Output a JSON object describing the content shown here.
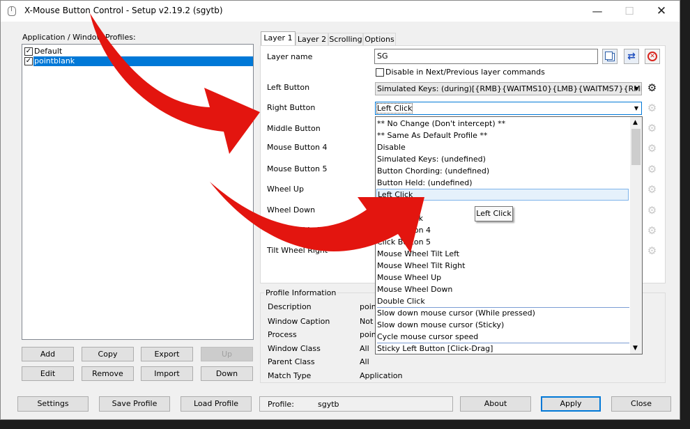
{
  "window": {
    "title": "X-Mouse Button Control - Setup v2.19.2 (sgytb)"
  },
  "profiles": {
    "header": "Application / Window Profiles:",
    "items": [
      {
        "label": "Default",
        "checked": true,
        "selected": false
      },
      {
        "label": "pointblank",
        "checked": true,
        "selected": true
      }
    ],
    "buttons": {
      "add": "Add",
      "copy": "Copy",
      "export": "Export",
      "up": "Up",
      "edit": "Edit",
      "remove": "Remove",
      "import": "Import",
      "down": "Down"
    }
  },
  "tabs": [
    "Layer 1",
    "Layer 2",
    "Scrolling",
    "Options"
  ],
  "layer": {
    "name_label": "Layer name",
    "name_value": "SG",
    "disable_label": "Disable in Next/Previous layer commands",
    "rows": [
      {
        "label": "Left Button",
        "value": "Simulated Keys: (during)[{RMB}{WAITMS10}{LMB}{WAITMS7}{RMB}{M..."
      },
      {
        "label": "Right Button",
        "value": "Left Click"
      },
      {
        "label": "Middle Button"
      },
      {
        "label": "Mouse Button 4"
      },
      {
        "label": "Mouse Button 5"
      },
      {
        "label": "Wheel Up"
      },
      {
        "label": "Wheel Down"
      },
      {
        "label": "Tilt Wheel Left"
      },
      {
        "label": "Tilt Wheel Right"
      }
    ]
  },
  "dropdown": {
    "items": [
      "** No Change (Don't intercept) **",
      "** Same As Default Profile **",
      "Disable",
      "Simulated Keys: (undefined)",
      "Button Chording: (undefined)",
      "Button Held: (undefined)",
      "Left Click",
      "Right Click",
      "Middle Click",
      "Click Button 4",
      "Click Button 5",
      "Mouse Wheel Tilt Left",
      "Mouse Wheel Tilt Right",
      "Mouse Wheel Up",
      "Mouse Wheel Down",
      "Double Click",
      "Slow down mouse cursor (While pressed)",
      "Slow down mouse cursor (Sticky)",
      "Cycle mouse cursor speed",
      "Sticky Left Button [Click-Drag]"
    ],
    "selected": "Left Click",
    "tooltip": "Left Click"
  },
  "profile_info": {
    "header": "Profile Information",
    "rows": [
      {
        "label": "Description",
        "value": "point"
      },
      {
        "label": "Window Caption",
        "value": "Not s"
      },
      {
        "label": "Process",
        "value": "point"
      },
      {
        "label": "Window Class",
        "value": "All"
      },
      {
        "label": "Parent Class",
        "value": "All"
      },
      {
        "label": "Match Type",
        "value": "Application"
      }
    ]
  },
  "footer": {
    "settings": "Settings",
    "save_profile": "Save Profile",
    "load_profile": "Load Profile",
    "profile_label": "Profile:",
    "profile_value": "sgytb",
    "about": "About",
    "apply": "Apply",
    "close": "Close"
  },
  "colors": {
    "selection": "#0078d7",
    "arrow": "#e3150f"
  },
  "icons": [
    "app-icon",
    "minimize-icon",
    "maximize-icon",
    "close-icon",
    "copy-layer-icon",
    "swap-layer-icon",
    "clear-layer-icon",
    "gear-icon",
    "chevron-down-icon"
  ]
}
